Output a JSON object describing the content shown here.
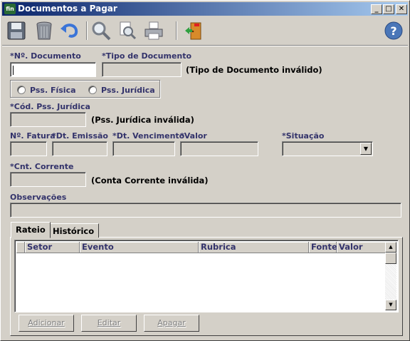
{
  "window": {
    "title": "Documentos a Pagar",
    "app_icon_text": "fin",
    "controls": {
      "minimize": "_",
      "maximize": "□",
      "close": "✕"
    }
  },
  "toolbar": {
    "buttons": [
      {
        "name": "save",
        "icon": "floppy-disk-icon"
      },
      {
        "name": "delete",
        "icon": "trash-bin-icon"
      },
      {
        "name": "undo",
        "icon": "undo-arrow-icon"
      },
      {
        "name": "search",
        "icon": "magnifier-icon"
      },
      {
        "name": "preview",
        "icon": "print-preview-icon"
      },
      {
        "name": "print",
        "icon": "printer-icon"
      },
      {
        "name": "exit",
        "icon": "exit-door-icon"
      },
      {
        "name": "help",
        "icon": "help-icon"
      }
    ],
    "help_glyph": "?"
  },
  "form": {
    "nr_documento": {
      "label": "*Nº. Documento",
      "value": ""
    },
    "tipo_documento": {
      "label": "*Tipo de Documento",
      "value": "",
      "message": "(Tipo de Documento inválido)"
    },
    "pessoa": {
      "fisica_label": "Pss. Física",
      "juridica_label": "Pss. Jurídica"
    },
    "cod_pss_juridica": {
      "label": "*Cód. Pss. Jurídica",
      "value": "",
      "message": "(Pss. Jurídica inválida)"
    },
    "nr_fatura": {
      "label": "Nº. Fatura",
      "value": ""
    },
    "dt_emissao": {
      "label": "*Dt. Emissão",
      "value": ""
    },
    "dt_vencimento": {
      "label": "*Dt. Vencimento",
      "value": ""
    },
    "valor": {
      "label": "*Valor",
      "value": ""
    },
    "situacao": {
      "label": "*Situação",
      "value": ""
    },
    "cnt_corrente": {
      "label": "*Cnt. Corrente",
      "value": "",
      "message": "(Conta Corrente inválida)"
    },
    "observacoes": {
      "label": "Observações",
      "value": ""
    }
  },
  "tabs": [
    {
      "label": "Rateio",
      "active": true
    },
    {
      "label": "Histórico",
      "active": false
    }
  ],
  "grid": {
    "columns": [
      "Setor",
      "Evento",
      "Rubrica",
      "Fonte",
      "Valor"
    ],
    "rows": []
  },
  "actions": {
    "add": "Adicionar",
    "edit": "Editar",
    "delete": "Apagar"
  }
}
